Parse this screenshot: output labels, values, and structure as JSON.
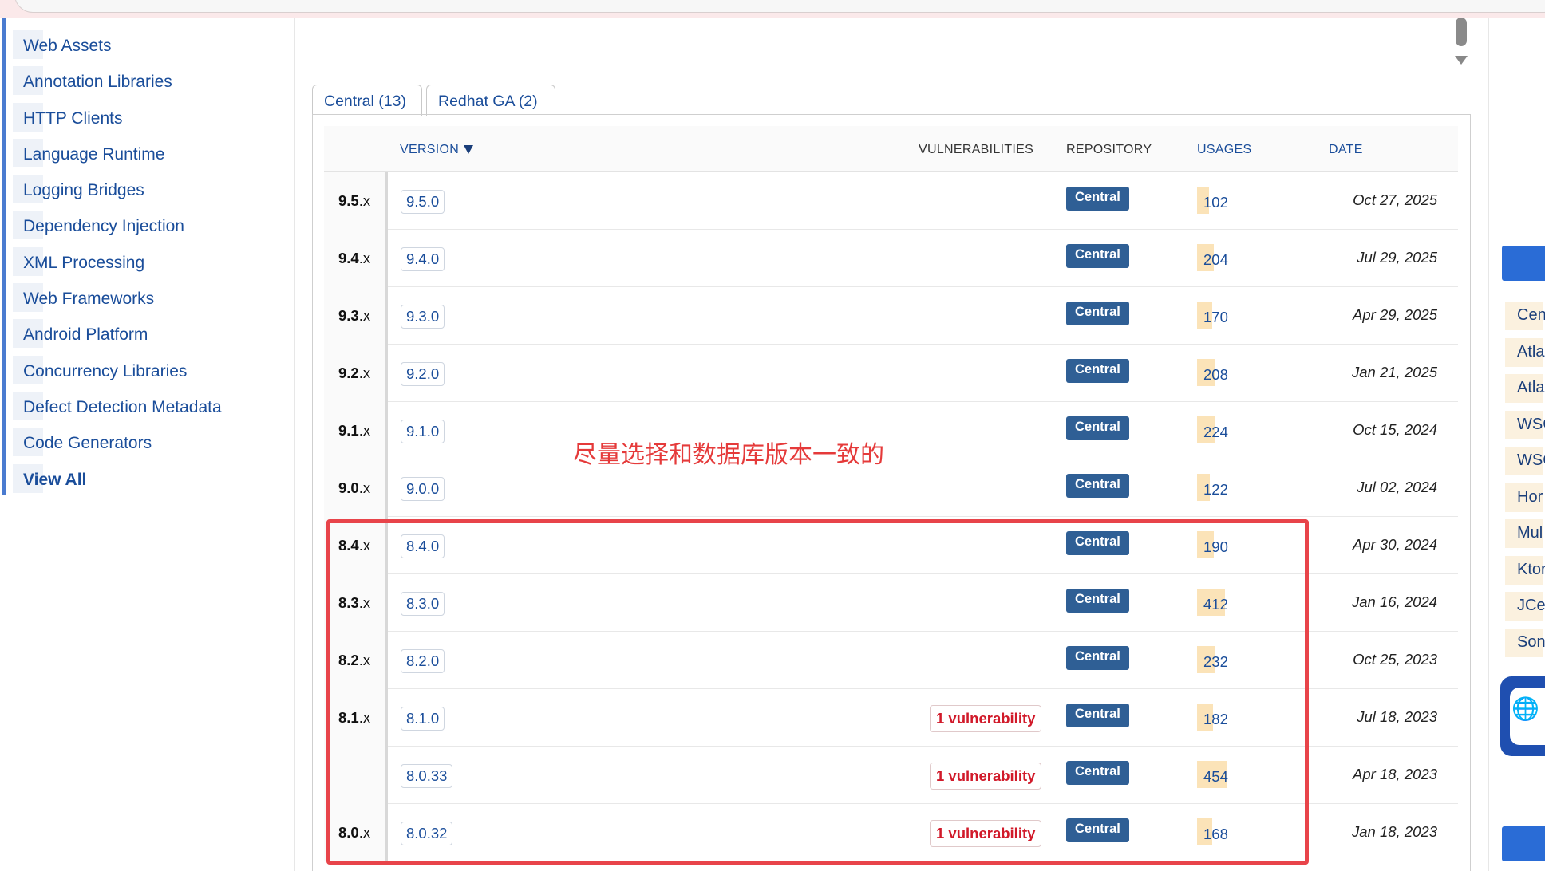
{
  "sidebar": {
    "items": [
      {
        "label": "Web Assets"
      },
      {
        "label": "Annotation Libraries"
      },
      {
        "label": "HTTP Clients"
      },
      {
        "label": "Language Runtime"
      },
      {
        "label": "Logging Bridges"
      },
      {
        "label": "Dependency Injection"
      },
      {
        "label": "XML Processing"
      },
      {
        "label": "Web Frameworks"
      },
      {
        "label": "Android Platform"
      },
      {
        "label": "Concurrency Libraries"
      },
      {
        "label": "Defect Detection Metadata"
      },
      {
        "label": "Code Generators"
      },
      {
        "label": "View All"
      }
    ]
  },
  "tabs": [
    {
      "label": "Central (13)"
    },
    {
      "label": "Redhat GA (2)"
    }
  ],
  "table": {
    "headers": {
      "version": "Version",
      "vulnerabilities": "Vulnerabilities",
      "repository": "Repository",
      "usages": "Usages",
      "date": "Date"
    },
    "rows": [
      {
        "group_major": "9.5",
        "group_suffix": ".x",
        "version": "9.5.0",
        "vulnerability": "",
        "repository": "Central",
        "usages": "102",
        "date": "Oct 27, 2025"
      },
      {
        "group_major": "9.4",
        "group_suffix": ".x",
        "version": "9.4.0",
        "vulnerability": "",
        "repository": "Central",
        "usages": "204",
        "date": "Jul 29, 2025"
      },
      {
        "group_major": "9.3",
        "group_suffix": ".x",
        "version": "9.3.0",
        "vulnerability": "",
        "repository": "Central",
        "usages": "170",
        "date": "Apr 29, 2025"
      },
      {
        "group_major": "9.2",
        "group_suffix": ".x",
        "version": "9.2.0",
        "vulnerability": "",
        "repository": "Central",
        "usages": "208",
        "date": "Jan 21, 2025"
      },
      {
        "group_major": "9.1",
        "group_suffix": ".x",
        "version": "9.1.0",
        "vulnerability": "",
        "repository": "Central",
        "usages": "224",
        "date": "Oct 15, 2024"
      },
      {
        "group_major": "9.0",
        "group_suffix": ".x",
        "version": "9.0.0",
        "vulnerability": "",
        "repository": "Central",
        "usages": "122",
        "date": "Jul 02, 2024"
      },
      {
        "group_major": "8.4",
        "group_suffix": ".x",
        "version": "8.4.0",
        "vulnerability": "",
        "repository": "Central",
        "usages": "190",
        "date": "Apr 30, 2024"
      },
      {
        "group_major": "8.3",
        "group_suffix": ".x",
        "version": "8.3.0",
        "vulnerability": "",
        "repository": "Central",
        "usages": "412",
        "date": "Jan 16, 2024"
      },
      {
        "group_major": "8.2",
        "group_suffix": ".x",
        "version": "8.2.0",
        "vulnerability": "",
        "repository": "Central",
        "usages": "232",
        "date": "Oct 25, 2023"
      },
      {
        "group_major": "8.1",
        "group_suffix": ".x",
        "version": "8.1.0",
        "vulnerability": "1 vulnerability",
        "repository": "Central",
        "usages": "182",
        "date": "Jul 18, 2023"
      },
      {
        "group_major": "",
        "group_suffix": "",
        "version": "8.0.33",
        "vulnerability": "1 vulnerability",
        "repository": "Central",
        "usages": "454",
        "date": "Apr 18, 2023"
      },
      {
        "group_major": "8.0",
        "group_suffix": ".x",
        "version": "8.0.32",
        "vulnerability": "1 vulnerability",
        "repository": "Central",
        "usages": "168",
        "date": "Jan 18, 2023"
      }
    ]
  },
  "annotation": {
    "text": "尽量选择和数据库版本一致的",
    "color": "#e53a3a"
  },
  "right_panel": {
    "items": [
      "Cent",
      "Atla",
      "Atla",
      "WSC",
      "WSC",
      "Hor",
      "Mul",
      "Ktor",
      "JCer",
      "Sona"
    ],
    "card_icon": "globe-icon"
  },
  "colors": {
    "link": "#1a4d9a",
    "repo_badge": "#2f5f95",
    "vulnerability": "#d11a2a",
    "usage_bar": "#fbe3b8"
  }
}
